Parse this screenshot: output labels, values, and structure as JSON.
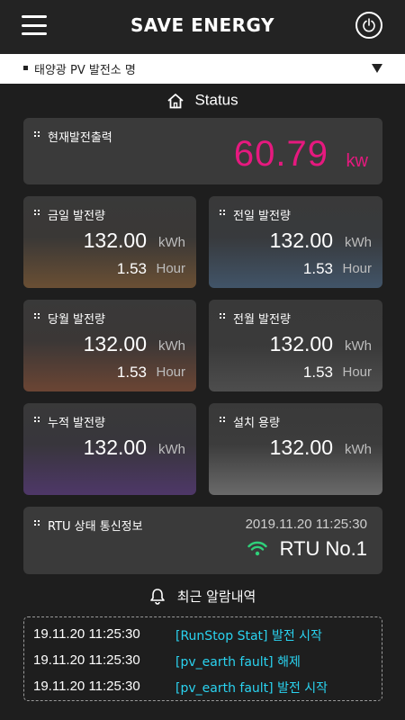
{
  "header": {
    "title": "SAVE ENERGY"
  },
  "plant_select": {
    "selected": "태양광 PV 발전소 명"
  },
  "status": {
    "title": "Status"
  },
  "current_output": {
    "label": "현재발전출력",
    "value": "60.79",
    "unit": "kw"
  },
  "cards": [
    {
      "label": "금일 발전량",
      "value": "132.00",
      "unit": "kWh",
      "hours": "1.53",
      "hour_unit": "Hour"
    },
    {
      "label": "전일 발전량",
      "value": "132.00",
      "unit": "kWh",
      "hours": "1.53",
      "hour_unit": "Hour"
    },
    {
      "label": "당월 발전량",
      "value": "132.00",
      "unit": "kWh",
      "hours": "1.53",
      "hour_unit": "Hour"
    },
    {
      "label": "전월 발전량",
      "value": "132.00",
      "unit": "kWh",
      "hours": "1.53",
      "hour_unit": "Hour"
    },
    {
      "label": "누적 발전량",
      "value": "132.00",
      "unit": "kWh"
    },
    {
      "label": "설치 용량",
      "value": "132.00",
      "unit": "kWh"
    }
  ],
  "rtu": {
    "label": "RTU 상태 통신정보",
    "timestamp": "2019.11.20  11:25:30",
    "name": "RTU No.1"
  },
  "alarms": {
    "title": "최근 알람내역",
    "items": [
      {
        "time": "19.11.20  11:25:30",
        "message": "[RunStop Stat] 발전 시작"
      },
      {
        "time": "19.11.20  11:25:30",
        "message": "[pv_earth fault] 해제"
      },
      {
        "time": "19.11.20  11:25:30",
        "message": "[pv_earth fault] 발전 시작"
      }
    ]
  },
  "colors": {
    "accent_magenta": "#e6197f",
    "alarm_cyan": "#2ad3f0",
    "wifi_green": "#2fd17a",
    "background": "#1e1e1e",
    "card": "#3a3a3a"
  },
  "icons": [
    "menu-icon",
    "power-icon",
    "dropdown-arrow-icon",
    "home-icon",
    "wifi-icon",
    "bell-icon"
  ]
}
